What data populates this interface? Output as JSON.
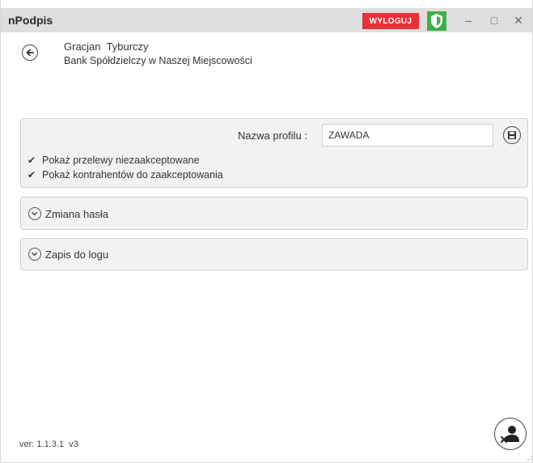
{
  "window": {
    "title": "nPodpis",
    "logout_label": "WYLOGUJ",
    "minimize_glyph": "–",
    "maximize_glyph": "□",
    "close_glyph": "✕"
  },
  "header": {
    "user_name": "Gracjan  Tyburczy",
    "bank_name": "Bank Spółdzielczy w Naszej Miejscowości"
  },
  "profile": {
    "label": "Nazwa profilu :",
    "value": "ZAWADA",
    "checkboxes": [
      {
        "label": "Pokaż przelewy niezaakceptowane",
        "checked": true
      },
      {
        "label": "Pokaż kontrahentów do zaakceptowania",
        "checked": true
      }
    ]
  },
  "sections": [
    {
      "label": "Zmiana hasła"
    },
    {
      "label": "Zapis do logu"
    }
  ],
  "footer": {
    "version": "ver: 1.1.3.1  v3"
  },
  "colors": {
    "accent_logout": "#e8323a",
    "shield": "#3fae49"
  },
  "icons": [
    "back-arrow-icon",
    "shield-icon",
    "save-icon",
    "chevron-down-icon",
    "user-remove-icon"
  ]
}
